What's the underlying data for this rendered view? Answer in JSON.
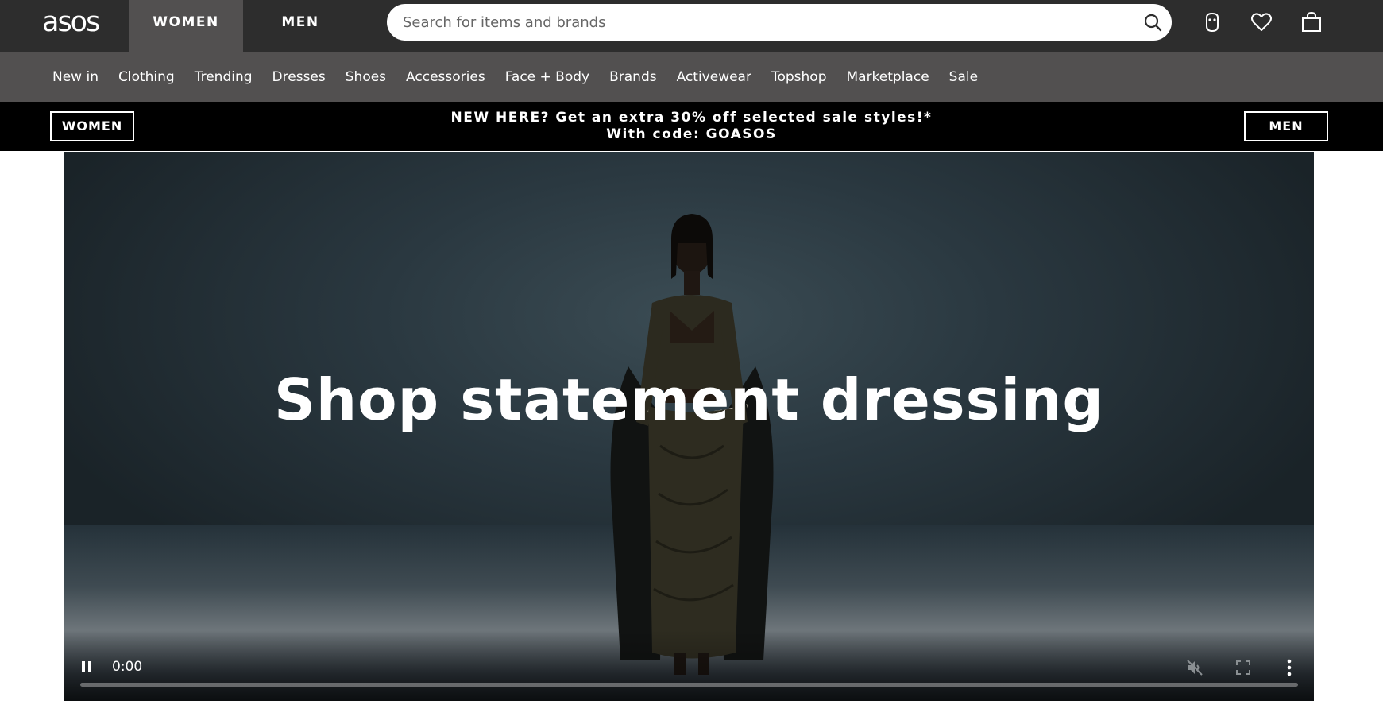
{
  "header": {
    "logo_text": "asos",
    "gender_tabs": [
      "WOMEN",
      "MEN"
    ],
    "search_placeholder": "Search for items and brands",
    "icons": [
      "search-icon",
      "account-icon",
      "heart-icon",
      "bag-icon"
    ]
  },
  "nav": {
    "items": [
      "New in",
      "Clothing",
      "Trending",
      "Dresses",
      "Shoes",
      "Accessories",
      "Face + Body",
      "Brands",
      "Activewear",
      "Topshop",
      "Marketplace",
      "Sale"
    ]
  },
  "promo": {
    "left_button": "WOMEN",
    "right_button": "MEN",
    "line1": "NEW HERE? Get an extra 30% off selected sale styles!*",
    "line2": "With code: GOASOS"
  },
  "hero": {
    "title": "Shop statement dressing",
    "video": {
      "time": "0:00",
      "progress": 0,
      "muted": true,
      "icons": [
        "pause-icon",
        "muted-icon",
        "fullscreen-icon",
        "more-vertical-icon"
      ]
    }
  },
  "colors": {
    "header_bg": "#2d2d2d",
    "nav_bg": "#525050",
    "promo_bg": "#000000",
    "hero_bg": "#2a3840"
  }
}
